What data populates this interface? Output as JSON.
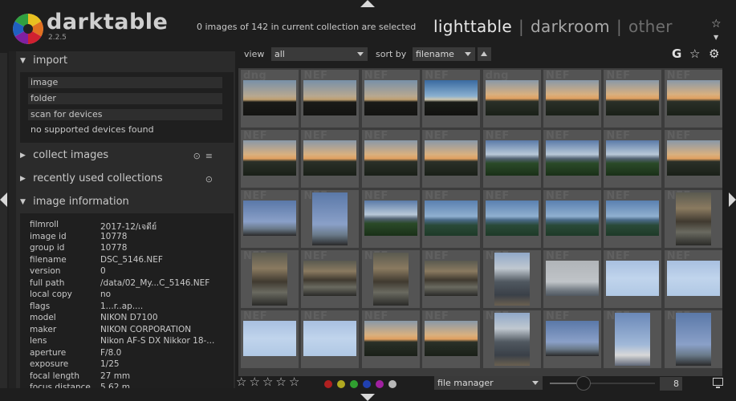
{
  "header": {
    "app_name": "darktable",
    "version": "2.2.5",
    "selection_status": "0 images of 142 in current collection are selected",
    "views": [
      {
        "label": "lighttable",
        "state": "active"
      },
      {
        "label": "darkroom",
        "state": "normal"
      },
      {
        "label": "other",
        "state": "dim"
      }
    ],
    "view_separator": "|"
  },
  "left_panel": {
    "import": {
      "title": "import",
      "buttons": [
        "image",
        "folder",
        "scan for devices"
      ],
      "status": "no supported devices found"
    },
    "collect_images": {
      "title": "collect images"
    },
    "recently_used": {
      "title": "recently used collections"
    },
    "image_information": {
      "title": "image information",
      "rows": [
        {
          "key": "filmroll",
          "value": "2017-12/เจดีย์"
        },
        {
          "key": "image id",
          "value": "10778"
        },
        {
          "key": "group id",
          "value": "10778"
        },
        {
          "key": "filename",
          "value": "DSC_5146.NEF"
        },
        {
          "key": "version",
          "value": "0"
        },
        {
          "key": "full path",
          "value": "/data/02_My...C_5146.NEF"
        },
        {
          "key": "local copy",
          "value": "no"
        },
        {
          "key": "flags",
          "value": "1...r..ap...."
        },
        {
          "key": "model",
          "value": "NIKON D7100"
        },
        {
          "key": "maker",
          "value": "NIKON CORPORATION"
        },
        {
          "key": "lens",
          "value": "Nikon AF-S DX Nikkor 18-..."
        },
        {
          "key": "aperture",
          "value": "F/8.0"
        },
        {
          "key": "exposure",
          "value": "1/25"
        },
        {
          "key": "focal length",
          "value": "27 mm"
        },
        {
          "key": "focus distance",
          "value": "5.62 m"
        }
      ]
    }
  },
  "filter_bar": {
    "view_label": "view",
    "view_value": "all",
    "sort_label": "sort by",
    "sort_value": "filename",
    "icons": [
      "grouping-icon",
      "star-icon",
      "gear-icon"
    ]
  },
  "thumbnails": [
    {
      "ext": "dng",
      "kind": "dusk-dark"
    },
    {
      "ext": "NEF",
      "kind": "dusk-dark"
    },
    {
      "ext": "NEF",
      "kind": "dusk-dark"
    },
    {
      "ext": "NEF",
      "kind": "dusk-blue"
    },
    {
      "ext": "dng",
      "kind": "dusk-orange"
    },
    {
      "ext": "NEF",
      "kind": "dusk-orange"
    },
    {
      "ext": "NEF",
      "kind": "dusk-orange"
    },
    {
      "ext": "NEF",
      "kind": "dusk-orange"
    },
    {
      "ext": "NEF",
      "kind": "dusk-orange"
    },
    {
      "ext": "NEF",
      "kind": "dusk-orange"
    },
    {
      "ext": "NEF",
      "kind": "dusk-orange"
    },
    {
      "ext": "NEF",
      "kind": "dusk-orange"
    },
    {
      "ext": "NEF",
      "kind": "green-valley"
    },
    {
      "ext": "NEF",
      "kind": "green-valley"
    },
    {
      "ext": "NEF",
      "kind": "green-valley"
    },
    {
      "ext": "NEF",
      "kind": "dusk-orange"
    },
    {
      "ext": "NEF",
      "kind": "pagoda-sky"
    },
    {
      "ext": "NEF",
      "kind": "pagoda-sky"
    },
    {
      "ext": "NEF",
      "kind": "green-valley"
    },
    {
      "ext": "NEF",
      "kind": "blue-valley"
    },
    {
      "ext": "NEF",
      "kind": "blue-valley"
    },
    {
      "ext": "NEF",
      "kind": "blue-valley"
    },
    {
      "ext": "NEF",
      "kind": "blue-valley"
    },
    {
      "ext": "NEF",
      "kind": "reflection"
    },
    {
      "ext": "NEF",
      "kind": "reflection"
    },
    {
      "ext": "NEF",
      "kind": "reflection"
    },
    {
      "ext": "NEF",
      "kind": "reflection"
    },
    {
      "ext": "NEF",
      "kind": "reflection"
    },
    {
      "ext": "NEF",
      "kind": "person"
    },
    {
      "ext": "NEF",
      "kind": "grey-pagoda"
    },
    {
      "ext": "NEF",
      "kind": "pale-sky"
    },
    {
      "ext": "NEF",
      "kind": "pale-sky"
    },
    {
      "ext": "NEF",
      "kind": "pale-sky"
    },
    {
      "ext": "NEF",
      "kind": "pale-sky"
    },
    {
      "ext": "NEF",
      "kind": "dusk-orange"
    },
    {
      "ext": "NEF",
      "kind": "dusk-orange"
    },
    {
      "ext": "NEF",
      "kind": "person"
    },
    {
      "ext": "NEF",
      "kind": "pagoda-sky"
    },
    {
      "ext": "NEF",
      "kind": "pagoda-white"
    },
    {
      "ext": "NEF",
      "kind": "pagoda-sky"
    }
  ],
  "bottom_bar": {
    "stars": [
      "☆",
      "☆",
      "☆",
      "☆",
      "☆"
    ],
    "color_labels": [
      "#b02020",
      "#b0a820",
      "#30a030",
      "#2040b0",
      "#a020a0",
      "#b8b8b8"
    ],
    "layout_value": "file manager",
    "zoom_value": "8"
  },
  "colors": {
    "background": "#1e1e1e",
    "panel": "#2b2b2b",
    "grid_background": "#3c3c3c",
    "thumbnail_frame": "#545454",
    "text": "#c8c8c8"
  }
}
